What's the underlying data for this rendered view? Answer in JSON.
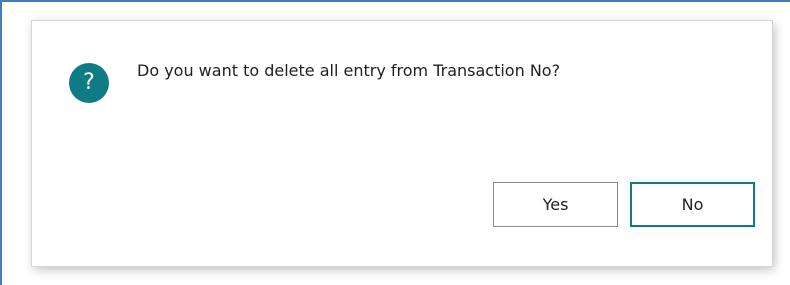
{
  "dialog": {
    "icon": "question-mark-icon",
    "icon_glyph": "?",
    "message": "Do you want to delete all entry from Transaction No?",
    "buttons": {
      "yes": "Yes",
      "no": "No"
    }
  },
  "colors": {
    "accent": "#0f7b85",
    "text": "#212121",
    "frame": "#3c7fbf"
  }
}
